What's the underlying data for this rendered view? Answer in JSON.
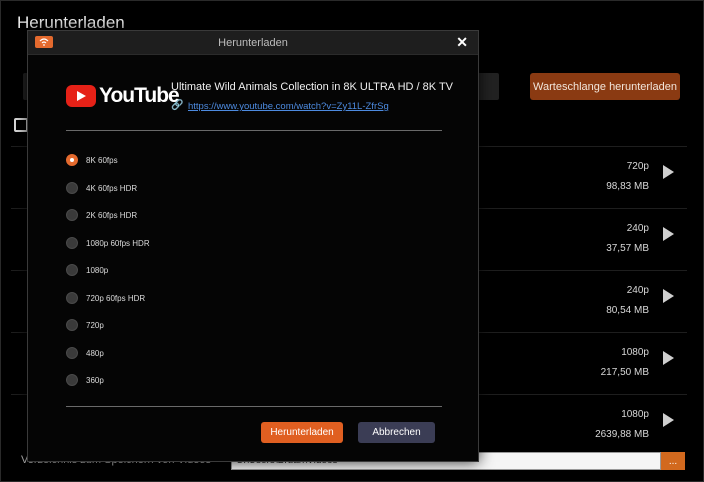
{
  "background": {
    "title": "Herunterladen",
    "queue_button": "Warteschlange herunterladen",
    "items": [
      {
        "resolution": "720p",
        "size": "98,83 MB"
      },
      {
        "resolution": "240p",
        "size": "37,57 MB"
      },
      {
        "resolution": "240p",
        "size": "80,54 MB"
      },
      {
        "resolution": "1080p",
        "size": "217,50 MB"
      },
      {
        "resolution": "1080p",
        "size": "2639,88 MB"
      }
    ],
    "path_label": "Verzeichnis zum Speichern von Videos",
    "path_value": "C:\\Users\\Bruan\\Videos",
    "browse_button": "..."
  },
  "modal": {
    "title": "Herunterladen",
    "close_label": "✕",
    "logo_text": "YouTube",
    "video_title": "Ultimate Wild Animals Collection in 8K ULTRA HD / 8K TV",
    "video_url": "https://www.youtube.com/watch?v=Zy11L-ZfrSg",
    "options": [
      "8K 60fps",
      "4K 60fps HDR",
      "2K 60fps HDR",
      "1080p 60fps HDR",
      "1080p",
      "720p 60fps HDR",
      "720p",
      "480p",
      "360p"
    ],
    "selected_option": "8K 60fps",
    "download_button": "Herunterladen",
    "cancel_button": "Abbrechen"
  },
  "colors": {
    "accent": "#e46a2e",
    "queue_button_bg": "#8a3a12",
    "cancel_bg": "#3b3d55",
    "link": "#4d8be0",
    "youtube_red": "#e62117"
  }
}
